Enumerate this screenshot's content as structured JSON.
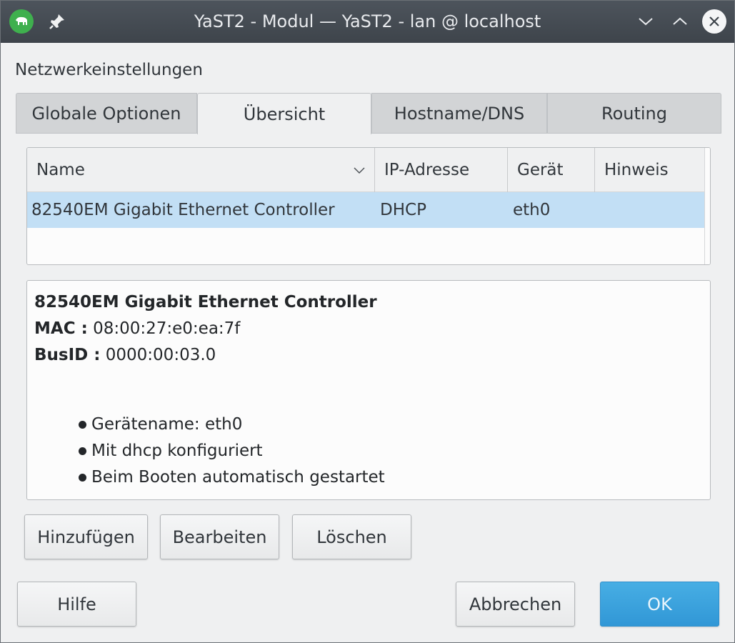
{
  "window": {
    "title": "YaST2 - Modul — YaST2 - lan @ localhost",
    "app_icon": "yast-chameleon-icon",
    "pin_icon": "pin-icon",
    "controls": [
      "minimize-icon",
      "maximize-icon",
      "close-icon"
    ]
  },
  "section_label": "Netzwerkeinstellungen",
  "tabs": [
    {
      "label": "Globale Optionen",
      "active": false
    },
    {
      "label": "Übersicht",
      "active": true
    },
    {
      "label": "Hostname/DNS",
      "active": false
    },
    {
      "label": "Routing",
      "active": false
    }
  ],
  "table": {
    "columns": [
      "Name",
      "IP-Adresse",
      "Gerät",
      "Hinweis"
    ],
    "sort_column": "Name",
    "rows": [
      {
        "name": "82540EM Gigabit Ethernet Controller",
        "ip": "DHCP",
        "device": "eth0",
        "note": "",
        "selected": true
      }
    ]
  },
  "details": {
    "title": "82540EM Gigabit Ethernet Controller",
    "mac_label": "MAC :",
    "mac_value": "08:00:27:e0:ea:7f",
    "busid_label": "BusID :",
    "busid_value": "0000:00:03.0",
    "bullets": [
      "Gerätename: eth0",
      "Mit dhcp konfiguriert",
      "Beim Booten automatisch gestartet"
    ]
  },
  "buttons": {
    "add": "Hinzufügen",
    "edit": "Bearbeiten",
    "delete": "Löschen",
    "help": "Hilfe",
    "cancel": "Abbrechen",
    "ok": "OK"
  },
  "colors": {
    "titlebar": "#474d54",
    "selection": "#c2dff5",
    "ok_button": "#3daee9",
    "app_icon": "#3fb04e"
  }
}
